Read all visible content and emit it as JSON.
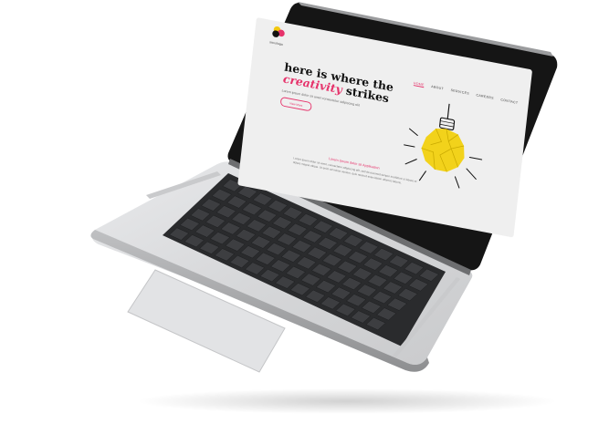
{
  "site": {
    "logo_text": "sanslogo"
  },
  "nav": {
    "items": [
      "HOME",
      "ABOUT",
      "SERVICES",
      "CAREERS",
      "CONTACT"
    ]
  },
  "hero": {
    "headline_line1": "here is where the",
    "headline_pink": "creativity",
    "headline_end": "strikes",
    "subline": "Lorem ipsum dolor sit amet consectetur adipiscing elit",
    "cta_label": "View More"
  },
  "section": {
    "tagline": "Lorem Ipsum dolor sit Application",
    "paragraph": "Lorem ipsum dolor sit amet, consectetur adipiscing elit, sed do eiusmod tempor incididunt ut labore et dolore magna aliqua. Ut enim ad minim veniam, quis nostrud exercitation ullamco laboris."
  },
  "colors": {
    "accent": "#e6336b",
    "bulb": "#f2d21b",
    "laptop_body": "#d9dadc",
    "keys": "#3d3e41"
  }
}
